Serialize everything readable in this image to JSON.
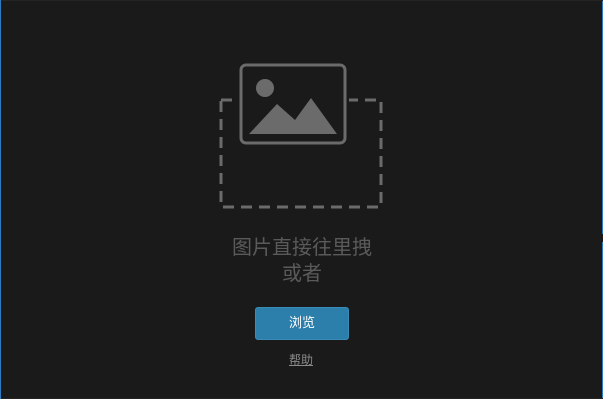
{
  "drop_zone": {
    "placeholder_icon": "image-icon",
    "prompt_line1": "图片直接往里拽",
    "prompt_line2": "或者"
  },
  "actions": {
    "browse_label": "浏览",
    "help_label": "帮助"
  },
  "colors": {
    "background": "#1a1a1a",
    "window_border": "#2e7bc4",
    "icon_gray": "#6b6b6b",
    "prompt_text": "#5a5a5a",
    "browse_button": "#2d7fab",
    "browse_text": "#ffffff",
    "help_text": "#8a8a8a"
  }
}
